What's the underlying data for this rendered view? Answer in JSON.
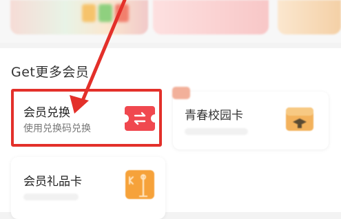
{
  "section": {
    "title": "Get更多会员"
  },
  "cards": {
    "exchange": {
      "title": "会员兑换",
      "subtitle": "使用兑换码兑换",
      "icon": "ticket-exchange-icon",
      "icon_color": "#f0484f",
      "highlight_color": "#e3302a"
    },
    "youth": {
      "title": "青春校园卡",
      "icon": "campus-box-icon",
      "icon_color": "#f3b25c"
    },
    "gift": {
      "title": "会员礼品卡",
      "icon": "gift-card-icon",
      "icon_color": "#f6a23a"
    }
  },
  "annotation": {
    "arrow_color": "#e3302a"
  }
}
